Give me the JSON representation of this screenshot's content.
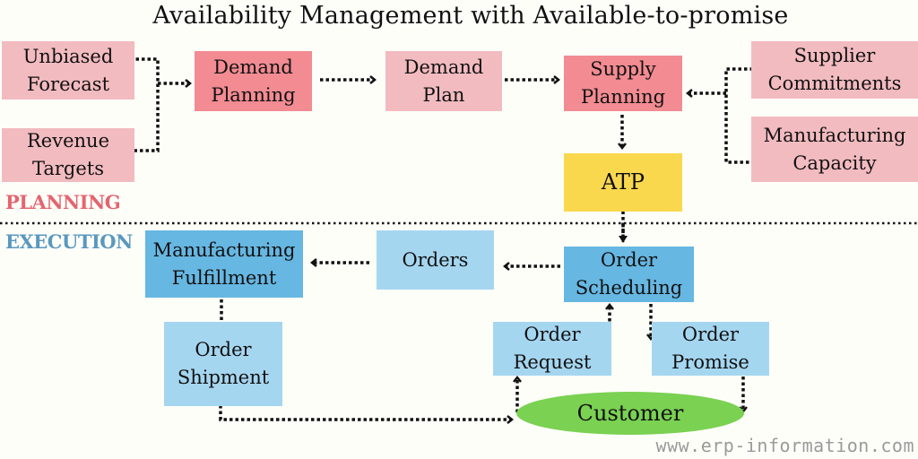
{
  "title": "Availability Management with Available-to-promise",
  "sections": {
    "planning": "PLANNING",
    "execution": "EXECUTION"
  },
  "nodes": {
    "unbiased_forecast": "Unbiased\nForecast",
    "revenue_targets": "Revenue\nTargets",
    "demand_planning": "Demand\nPlanning",
    "demand_plan": "Demand\nPlan",
    "supply_planning": "Supply\nPlanning",
    "supplier_commitments": "Supplier\nCommitments",
    "manufacturing_capacity": "Manufacturing\nCapacity",
    "atp": "ATP",
    "manufacturing_fulfillment": "Manufacturing\nFulfillment",
    "orders": "Orders",
    "order_scheduling": "Order\nScheduling",
    "order_shipment": "Order\nShipment",
    "order_request": "Order\nRequest",
    "order_promise": "Order\nPromise",
    "customer": "Customer"
  },
  "edges": [
    {
      "from": "Unbiased Forecast",
      "to": "Demand Planning"
    },
    {
      "from": "Revenue Targets",
      "to": "Demand Planning"
    },
    {
      "from": "Demand Planning",
      "to": "Demand Plan"
    },
    {
      "from": "Demand Plan",
      "to": "Supply Planning"
    },
    {
      "from": "Supplier Commitments",
      "to": "Supply Planning"
    },
    {
      "from": "Manufacturing Capacity",
      "to": "Supply Planning"
    },
    {
      "from": "Supply Planning",
      "to": "ATP"
    },
    {
      "from": "ATP",
      "to": "Order Scheduling",
      "bidirectional": true
    },
    {
      "from": "Order Scheduling",
      "to": "Orders"
    },
    {
      "from": "Orders",
      "to": "Manufacturing Fulfillment"
    },
    {
      "from": "Manufacturing Fulfillment",
      "to": "Order Shipment"
    },
    {
      "from": "Order Shipment",
      "to": "Customer"
    },
    {
      "from": "Customer",
      "to": "Order Request"
    },
    {
      "from": "Order Request",
      "to": "Order Scheduling"
    },
    {
      "from": "Order Scheduling",
      "to": "Order Promise"
    },
    {
      "from": "Order Promise",
      "to": "Customer"
    }
  ],
  "colors": {
    "planning_light": "#F2BBC0",
    "planning_dark": "#F28B92",
    "atp": "#FAD84E",
    "execution_dark": "#66B7E2",
    "execution_light": "#A5D6F0",
    "customer": "#7AD152",
    "planning_label": "#E36570",
    "execution_label": "#5A98BE"
  },
  "footer": "www.erp-information.com"
}
